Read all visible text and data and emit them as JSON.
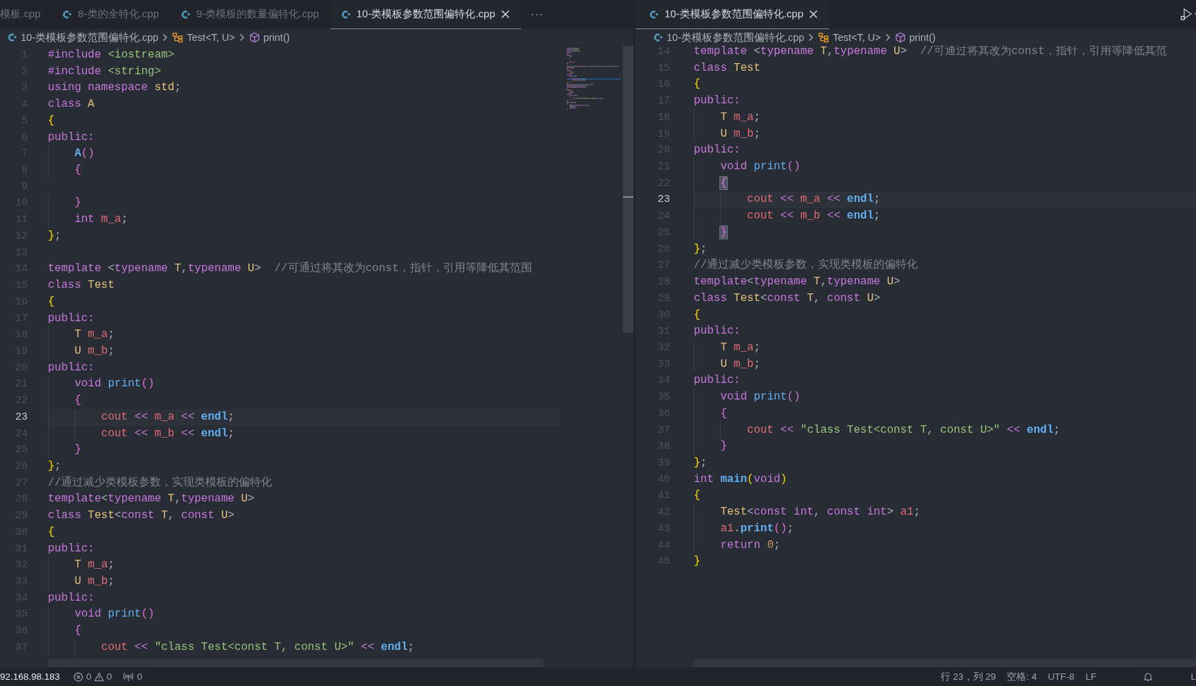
{
  "left_editor": {
    "tabs": [
      {
        "label": "模板.cpp",
        "selected": false,
        "file_icon": false
      },
      {
        "label": "8-类的全特化.cpp",
        "selected": false,
        "file_icon": true
      },
      {
        "label": "9-类模板的数量偏特化.cpp",
        "selected": false,
        "file_icon": true
      },
      {
        "label": "10-类模板参数范围偏特化.cpp",
        "selected": true,
        "file_icon": true
      }
    ],
    "more": "···",
    "breadcrumbs": [
      {
        "kind": "file",
        "text": "10-类模板参数范围偏特化.cpp"
      },
      {
        "kind": "class",
        "text": "Test<T, U>"
      },
      {
        "kind": "method",
        "text": "print()"
      }
    ],
    "lines": [
      {
        "number": "1",
        "current": false,
        "tokens": [
          {
            "kind": "kw",
            "text": "#include "
          },
          {
            "kind": "str",
            "text": "<iostream>"
          }
        ]
      },
      {
        "number": "2",
        "current": false,
        "tokens": [
          {
            "kind": "kw",
            "text": "#include "
          },
          {
            "kind": "str",
            "text": "<string>"
          }
        ]
      },
      {
        "number": "3",
        "current": false,
        "tokens": [
          {
            "kind": "kw",
            "text": "using namespace "
          },
          {
            "kind": "type",
            "text": "std"
          },
          {
            "kind": "p",
            "text": ";"
          }
        ]
      },
      {
        "number": "4",
        "current": false,
        "tokens": [
          {
            "kind": "kw",
            "text": "class "
          },
          {
            "kind": "type",
            "text": "A"
          }
        ]
      },
      {
        "number": "5",
        "current": false,
        "tokens": [
          {
            "kind": "b1",
            "text": "{"
          }
        ]
      },
      {
        "number": "6",
        "current": false,
        "tokens": [
          {
            "kind": "kw",
            "text": "public:"
          }
        ]
      },
      {
        "number": "7",
        "current": false,
        "tokens": [
          {
            "kind": "fnb",
            "text": "    A"
          },
          {
            "kind": "b2",
            "text": "()"
          }
        ]
      },
      {
        "number": "8",
        "current": false,
        "tokens": [
          {
            "kind": "b2",
            "text": "    {"
          }
        ]
      },
      {
        "number": "9",
        "current": false
      },
      {
        "number": "10",
        "current": false,
        "tokens": [
          {
            "kind": "b2",
            "text": "    }"
          }
        ]
      },
      {
        "number": "11",
        "current": false,
        "tokens": [
          {
            "kind": "kw",
            "text": "    int "
          },
          {
            "kind": "var",
            "text": "m_a"
          },
          {
            "kind": "p",
            "text": ";"
          }
        ]
      },
      {
        "number": "12",
        "current": false,
        "tokens": [
          {
            "kind": "b1",
            "text": "}"
          },
          {
            "kind": "p",
            "text": ";"
          }
        ]
      },
      {
        "number": "13",
        "current": false
      },
      {
        "number": "14",
        "current": false,
        "tokens": [
          {
            "kind": "kw",
            "text": "template "
          },
          {
            "kind": "p",
            "text": "<"
          },
          {
            "kind": "kw",
            "text": "typename "
          },
          {
            "kind": "type",
            "text": "T"
          },
          {
            "kind": "p",
            "text": ","
          },
          {
            "kind": "kw",
            "text": "typename "
          },
          {
            "kind": "type",
            "text": "U"
          },
          {
            "kind": "p",
            "text": ">  "
          },
          {
            "kind": "cm",
            "text": "//可通过将其改为const，指针，引用等降低其范围"
          }
        ]
      },
      {
        "number": "15",
        "current": false,
        "tokens": [
          {
            "kind": "kw",
            "text": "class "
          },
          {
            "kind": "type",
            "text": "Test"
          }
        ]
      },
      {
        "number": "16",
        "current": false,
        "tokens": [
          {
            "kind": "b1",
            "text": "{"
          }
        ]
      },
      {
        "number": "17",
        "current": false,
        "tokens": [
          {
            "kind": "kw",
            "text": "public:"
          }
        ]
      },
      {
        "number": "18",
        "current": false,
        "tokens": [
          {
            "kind": "type",
            "text": "    T "
          },
          {
            "kind": "var",
            "text": "m_a"
          },
          {
            "kind": "p",
            "text": ";"
          }
        ]
      },
      {
        "number": "19",
        "current": false,
        "tokens": [
          {
            "kind": "type",
            "text": "    U "
          },
          {
            "kind": "var",
            "text": "m_b"
          },
          {
            "kind": "p",
            "text": ";"
          }
        ]
      },
      {
        "number": "20",
        "current": false,
        "tokens": [
          {
            "kind": "kw",
            "text": "public:"
          }
        ]
      },
      {
        "number": "21",
        "current": false,
        "tokens": [
          {
            "kind": "kw",
            "text": "    void "
          },
          {
            "kind": "fn",
            "text": "print"
          },
          {
            "kind": "b2",
            "text": "()"
          }
        ]
      },
      {
        "number": "22",
        "current": false,
        "tokens": [
          {
            "kind": "b2",
            "text": "    {"
          }
        ]
      },
      {
        "number": "23",
        "current": true,
        "tokens": [
          {
            "kind": "var",
            "text": "        cout "
          },
          {
            "kind": "kw",
            "text": "<< "
          },
          {
            "kind": "var",
            "text": "m_a "
          },
          {
            "kind": "kw",
            "text": "<< "
          },
          {
            "kind": "fnb",
            "text": "endl"
          },
          {
            "kind": "p",
            "text": ";"
          }
        ]
      },
      {
        "number": "24",
        "current": false,
        "tokens": [
          {
            "kind": "var",
            "text": "        cout "
          },
          {
            "kind": "kw",
            "text": "<< "
          },
          {
            "kind": "var",
            "text": "m_b "
          },
          {
            "kind": "kw",
            "text": "<< "
          },
          {
            "kind": "fnb",
            "text": "endl"
          },
          {
            "kind": "p",
            "text": ";"
          }
        ]
      },
      {
        "number": "25",
        "current": false,
        "tokens": [
          {
            "kind": "b2",
            "text": "    }"
          }
        ]
      },
      {
        "number": "26",
        "current": false,
        "tokens": [
          {
            "kind": "b1",
            "text": "}"
          },
          {
            "kind": "p",
            "text": ";"
          }
        ]
      },
      {
        "number": "27",
        "current": false,
        "tokens": [
          {
            "kind": "cm",
            "text": "//通过减少类模板参数，实现类模板的偏特化"
          }
        ]
      },
      {
        "number": "28",
        "current": false,
        "tokens": [
          {
            "kind": "kw",
            "text": "template"
          },
          {
            "kind": "p",
            "text": "<"
          },
          {
            "kind": "kw",
            "text": "typename "
          },
          {
            "kind": "type",
            "text": "T"
          },
          {
            "kind": "p",
            "text": ","
          },
          {
            "kind": "kw",
            "text": "typename "
          },
          {
            "kind": "type",
            "text": "U"
          },
          {
            "kind": "p",
            "text": ">"
          }
        ]
      },
      {
        "number": "29",
        "current": false,
        "tokens": [
          {
            "kind": "kw",
            "text": "class "
          },
          {
            "kind": "type",
            "text": "Test"
          },
          {
            "kind": "p",
            "text": "<"
          },
          {
            "kind": "kw",
            "text": "const "
          },
          {
            "kind": "type",
            "text": "T"
          },
          {
            "kind": "p",
            "text": ", "
          },
          {
            "kind": "kw",
            "text": "const "
          },
          {
            "kind": "type",
            "text": "U"
          },
          {
            "kind": "p",
            "text": ">"
          }
        ]
      },
      {
        "number": "30",
        "current": false,
        "tokens": [
          {
            "kind": "b1",
            "text": "{"
          }
        ]
      },
      {
        "number": "31",
        "current": false,
        "tokens": [
          {
            "kind": "kw",
            "text": "public:"
          }
        ]
      },
      {
        "number": "32",
        "current": false,
        "tokens": [
          {
            "kind": "type",
            "text": "    T "
          },
          {
            "kind": "var",
            "text": "m_a"
          },
          {
            "kind": "p",
            "text": ";"
          }
        ]
      },
      {
        "number": "33",
        "current": false,
        "tokens": [
          {
            "kind": "type",
            "text": "    U "
          },
          {
            "kind": "var",
            "text": "m_b"
          },
          {
            "kind": "p",
            "text": ";"
          }
        ]
      },
      {
        "number": "34",
        "current": false,
        "tokens": [
          {
            "kind": "kw",
            "text": "public:"
          }
        ]
      },
      {
        "number": "35",
        "current": false,
        "tokens": [
          {
            "kind": "kw",
            "text": "    void "
          },
          {
            "kind": "fn",
            "text": "print"
          },
          {
            "kind": "b2",
            "text": "()"
          }
        ]
      },
      {
        "number": "36",
        "current": false,
        "tokens": [
          {
            "kind": "b2",
            "text": "    {"
          }
        ]
      },
      {
        "number": "37",
        "current": false,
        "tokens": [
          {
            "kind": "var",
            "text": "        cout "
          },
          {
            "kind": "kw",
            "text": "<< "
          },
          {
            "kind": "str",
            "text": "\"class Test<const T, const U>\""
          },
          {
            "kind": "kw",
            "text": " << "
          },
          {
            "kind": "fnb",
            "text": "endl"
          },
          {
            "kind": "p",
            "text": ";"
          }
        ]
      }
    ]
  },
  "right_editor": {
    "tabs": [
      {
        "label": "10-类模板参数范围偏特化.cpp",
        "selected": true,
        "file_icon": true
      }
    ],
    "breadcrumbs": [
      {
        "kind": "file",
        "text": "10-类模板参数范围偏特化.cpp"
      },
      {
        "kind": "class",
        "text": "Test<T, U>"
      },
      {
        "kind": "method",
        "text": "print()"
      }
    ],
    "lines": [
      {
        "number": "14",
        "current": false,
        "tokens": [
          {
            "kind": "kw",
            "text": "template "
          },
          {
            "kind": "p",
            "text": "<"
          },
          {
            "kind": "kw",
            "text": "typename "
          },
          {
            "kind": "type",
            "text": "T"
          },
          {
            "kind": "p",
            "text": ","
          },
          {
            "kind": "kw",
            "text": "typename "
          },
          {
            "kind": "type",
            "text": "U"
          },
          {
            "kind": "p",
            "text": ">  "
          },
          {
            "kind": "cm",
            "text": "//可通过将其改为const，指针，引用等降低其范"
          }
        ]
      },
      {
        "number": "15",
        "current": false,
        "tokens": [
          {
            "kind": "kw",
            "text": "class "
          },
          {
            "kind": "type",
            "text": "Test"
          }
        ]
      },
      {
        "number": "16",
        "current": false,
        "tokens": [
          {
            "kind": "b1",
            "text": "{"
          }
        ]
      },
      {
        "number": "17",
        "current": false,
        "tokens": [
          {
            "kind": "kw",
            "text": "public:"
          }
        ]
      },
      {
        "number": "18",
        "current": false,
        "tokens": [
          {
            "kind": "type",
            "text": "    T "
          },
          {
            "kind": "var",
            "text": "m_a"
          },
          {
            "kind": "p",
            "text": ";"
          }
        ]
      },
      {
        "number": "19",
        "current": false,
        "tokens": [
          {
            "kind": "type",
            "text": "    U "
          },
          {
            "kind": "var",
            "text": "m_b"
          },
          {
            "kind": "p",
            "text": ";"
          }
        ]
      },
      {
        "number": "20",
        "current": false,
        "tokens": [
          {
            "kind": "kw",
            "text": "public:"
          }
        ]
      },
      {
        "number": "21",
        "current": false,
        "tokens": [
          {
            "kind": "kw",
            "text": "    void "
          },
          {
            "kind": "fn",
            "text": "print"
          },
          {
            "kind": "b2",
            "text": "()"
          }
        ]
      },
      {
        "number": "22",
        "current": false,
        "tokens": [
          {
            "kind": "bm",
            "text": "    {"
          }
        ]
      },
      {
        "number": "23",
        "current": true,
        "tokens": [
          {
            "kind": "var",
            "text": "        cout "
          },
          {
            "kind": "kw",
            "text": "<< "
          },
          {
            "kind": "var",
            "text": "m_a "
          },
          {
            "kind": "kw",
            "text": "<< "
          },
          {
            "kind": "fnb",
            "text": "endl"
          },
          {
            "kind": "p",
            "text": ";"
          }
        ]
      },
      {
        "number": "24",
        "current": false,
        "tokens": [
          {
            "kind": "var",
            "text": "        cout "
          },
          {
            "kind": "kw",
            "text": "<< "
          },
          {
            "kind": "var",
            "text": "m_b "
          },
          {
            "kind": "kw",
            "text": "<< "
          },
          {
            "kind": "fnb",
            "text": "endl"
          },
          {
            "kind": "p",
            "text": ";"
          }
        ]
      },
      {
        "number": "25",
        "current": false,
        "tokens": [
          {
            "kind": "bm",
            "text": "    }"
          }
        ]
      },
      {
        "number": "26",
        "current": false,
        "tokens": [
          {
            "kind": "b1",
            "text": "}"
          },
          {
            "kind": "p",
            "text": ";"
          }
        ]
      },
      {
        "number": "27",
        "current": false,
        "tokens": [
          {
            "kind": "cm",
            "text": "//通过减少类模板参数，实现类模板的偏特化"
          }
        ]
      },
      {
        "number": "28",
        "current": false,
        "tokens": [
          {
            "kind": "kw",
            "text": "template"
          },
          {
            "kind": "p",
            "text": "<"
          },
          {
            "kind": "kw",
            "text": "typename "
          },
          {
            "kind": "type",
            "text": "T"
          },
          {
            "kind": "p",
            "text": ","
          },
          {
            "kind": "kw",
            "text": "typename "
          },
          {
            "kind": "type",
            "text": "U"
          },
          {
            "kind": "p",
            "text": ">"
          }
        ]
      },
      {
        "number": "29",
        "current": false,
        "tokens": [
          {
            "kind": "kw",
            "text": "class "
          },
          {
            "kind": "type",
            "text": "Test"
          },
          {
            "kind": "p",
            "text": "<"
          },
          {
            "kind": "kw",
            "text": "const "
          },
          {
            "kind": "type",
            "text": "T"
          },
          {
            "kind": "p",
            "text": ", "
          },
          {
            "kind": "kw",
            "text": "const "
          },
          {
            "kind": "type",
            "text": "U"
          },
          {
            "kind": "p",
            "text": ">"
          }
        ]
      },
      {
        "number": "30",
        "current": false,
        "tokens": [
          {
            "kind": "b1",
            "text": "{"
          }
        ]
      },
      {
        "number": "31",
        "current": false,
        "tokens": [
          {
            "kind": "kw",
            "text": "public:"
          }
        ]
      },
      {
        "number": "32",
        "current": false,
        "tokens": [
          {
            "kind": "type",
            "text": "    T "
          },
          {
            "kind": "var",
            "text": "m_a"
          },
          {
            "kind": "p",
            "text": ";"
          }
        ]
      },
      {
        "number": "33",
        "current": false,
        "tokens": [
          {
            "kind": "type",
            "text": "    U "
          },
          {
            "kind": "var",
            "text": "m_b"
          },
          {
            "kind": "p",
            "text": ";"
          }
        ]
      },
      {
        "number": "34",
        "current": false,
        "tokens": [
          {
            "kind": "kw",
            "text": "public:"
          }
        ]
      },
      {
        "number": "35",
        "current": false,
        "tokens": [
          {
            "kind": "kw",
            "text": "    void "
          },
          {
            "kind": "fn",
            "text": "print"
          },
          {
            "kind": "b2",
            "text": "()"
          }
        ]
      },
      {
        "number": "36",
        "current": false,
        "tokens": [
          {
            "kind": "b2",
            "text": "    {"
          }
        ]
      },
      {
        "number": "37",
        "current": false,
        "tokens": [
          {
            "kind": "var",
            "text": "        cout "
          },
          {
            "kind": "kw",
            "text": "<< "
          },
          {
            "kind": "str",
            "text": "\"class Test<const T, const U>\""
          },
          {
            "kind": "kw",
            "text": " << "
          },
          {
            "kind": "fnb",
            "text": "endl"
          },
          {
            "kind": "p",
            "text": ";"
          }
        ]
      },
      {
        "number": "38",
        "current": false,
        "tokens": [
          {
            "kind": "b2",
            "text": "    }"
          }
        ]
      },
      {
        "number": "39",
        "current": false,
        "tokens": [
          {
            "kind": "b1",
            "text": "}"
          },
          {
            "kind": "p",
            "text": ";"
          }
        ]
      },
      {
        "number": "40",
        "current": false,
        "tokens": [
          {
            "kind": "kw",
            "text": "int "
          },
          {
            "kind": "fnb",
            "text": "main"
          },
          {
            "kind": "b1",
            "text": "("
          },
          {
            "kind": "kw",
            "text": "void"
          },
          {
            "kind": "b1",
            "text": ")"
          }
        ]
      },
      {
        "number": "41",
        "current": false,
        "tokens": [
          {
            "kind": "b1",
            "text": "{"
          }
        ]
      },
      {
        "number": "42",
        "current": false,
        "tokens": [
          {
            "kind": "type",
            "text": "    Test"
          },
          {
            "kind": "p",
            "text": "<"
          },
          {
            "kind": "kw",
            "text": "const int"
          },
          {
            "kind": "p",
            "text": ", "
          },
          {
            "kind": "kw",
            "text": "const int"
          },
          {
            "kind": "p",
            "text": "> "
          },
          {
            "kind": "var",
            "text": "a1"
          },
          {
            "kind": "p",
            "text": ";"
          }
        ]
      },
      {
        "number": "43",
        "current": false,
        "tokens": [
          {
            "kind": "var",
            "text": "    a1"
          },
          {
            "kind": "p",
            "text": "."
          },
          {
            "kind": "fnb",
            "text": "print"
          },
          {
            "kind": "b2",
            "text": "()"
          },
          {
            "kind": "p",
            "text": ";"
          }
        ]
      },
      {
        "number": "44",
        "current": false,
        "tokens": [
          {
            "kind": "kw",
            "text": "    return "
          },
          {
            "kind": "num",
            "text": "0"
          },
          {
            "kind": "p",
            "text": ";"
          }
        ]
      },
      {
        "number": "45",
        "current": false,
        "tokens": [
          {
            "kind": "b1",
            "text": "}"
          }
        ]
      }
    ]
  },
  "status_bar": {
    "remote": "92.168.98.183",
    "errors": "0",
    "warnings": "0",
    "ports": "0",
    "position": "行 23，列 29",
    "indentation": "空格: 4",
    "encoding": "UTF-8",
    "line_ending": "LF",
    "cut_item": "L"
  }
}
